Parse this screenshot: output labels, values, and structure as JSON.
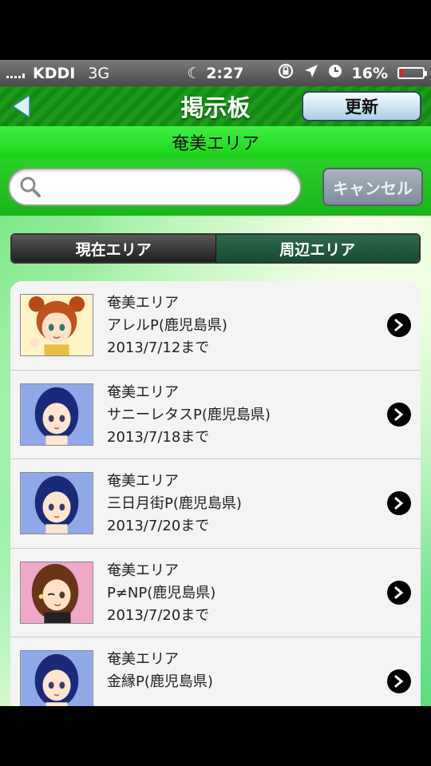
{
  "status_bar": {
    "carrier": "KDDI",
    "network": "3G",
    "time": "2:27",
    "battery": "16%"
  },
  "nav": {
    "title": "掲示板",
    "refresh_label": "更新",
    "back_icon": "back-arrow-icon"
  },
  "area_bar": {
    "label": "奄美エリア"
  },
  "search": {
    "placeholder": "",
    "value": "",
    "cancel_label": "キャンセル"
  },
  "segments": {
    "current": "現在エリア",
    "nearby": "周辺エリア",
    "selected": "current"
  },
  "boards": [
    {
      "area": "奄美エリア",
      "name": "アレルP(鹿児島県)",
      "until": "2013/7/12まで",
      "avatar_icon": "character-avatar-brown-hair"
    },
    {
      "area": "奄美エリア",
      "name": "サニーレタスP(鹿児島県)",
      "until": "2013/7/18まで",
      "avatar_icon": "character-avatar-blue-hair"
    },
    {
      "area": "奄美エリア",
      "name": "三日月街P(鹿児島県)",
      "until": "2013/7/20まで",
      "avatar_icon": "character-avatar-blue-hair"
    },
    {
      "area": "奄美エリア",
      "name": "P≠NP(鹿児島県)",
      "until": "2013/7/20まで",
      "avatar_icon": "character-avatar-brunette"
    },
    {
      "area": "奄美エリア",
      "name": "金縁P(鹿児島県)",
      "until": "",
      "avatar_icon": "character-avatar-blue-hair"
    }
  ]
}
